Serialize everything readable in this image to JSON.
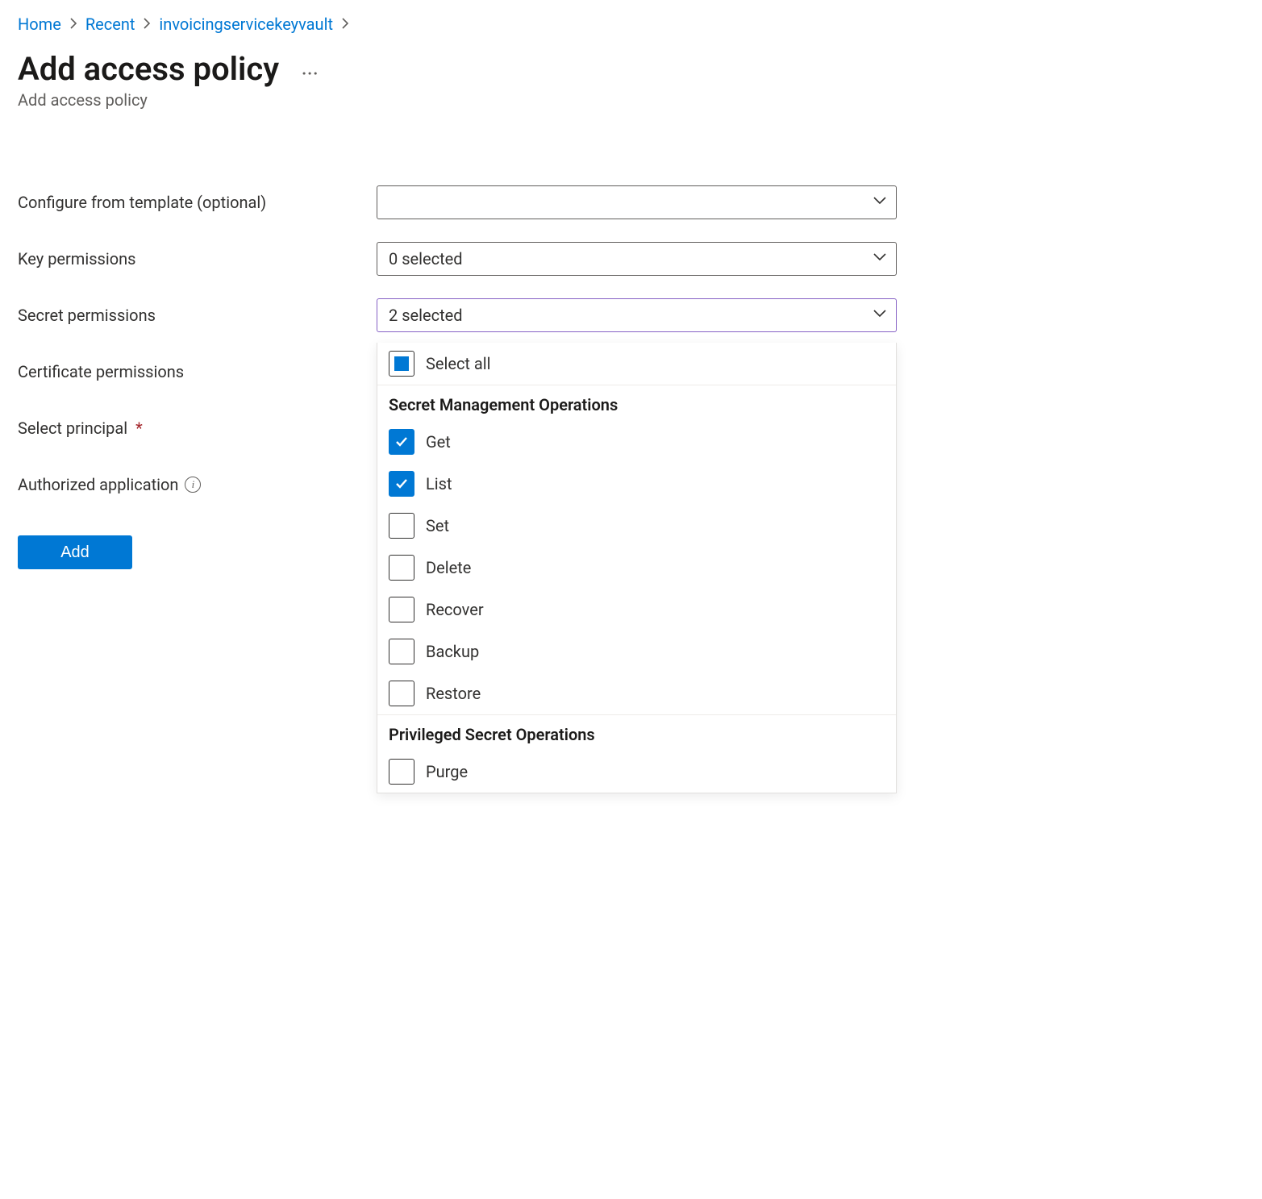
{
  "breadcrumb": {
    "items": [
      "Home",
      "Recent",
      "invoicingservicekeyvault"
    ]
  },
  "header": {
    "title": "Add access policy",
    "subtitle": "Add access policy"
  },
  "labels": {
    "template": "Configure from template (optional)",
    "key_permissions": "Key permissions",
    "secret_permissions": "Secret permissions",
    "certificate_permissions": "Certificate permissions",
    "select_principal": "Select principal",
    "authorized_application": "Authorized application"
  },
  "selects": {
    "template_value": "",
    "key_value": "0 selected",
    "secret_value": "2 selected"
  },
  "dropdown": {
    "select_all": "Select all",
    "group1_title": "Secret Management Operations",
    "group1_items": [
      {
        "label": "Get",
        "checked": true
      },
      {
        "label": "List",
        "checked": true
      },
      {
        "label": "Set",
        "checked": false
      },
      {
        "label": "Delete",
        "checked": false
      },
      {
        "label": "Recover",
        "checked": false
      },
      {
        "label": "Backup",
        "checked": false
      },
      {
        "label": "Restore",
        "checked": false
      }
    ],
    "group2_title": "Privileged Secret Operations",
    "group2_items": [
      {
        "label": "Purge",
        "checked": false
      }
    ]
  },
  "buttons": {
    "add": "Add"
  }
}
